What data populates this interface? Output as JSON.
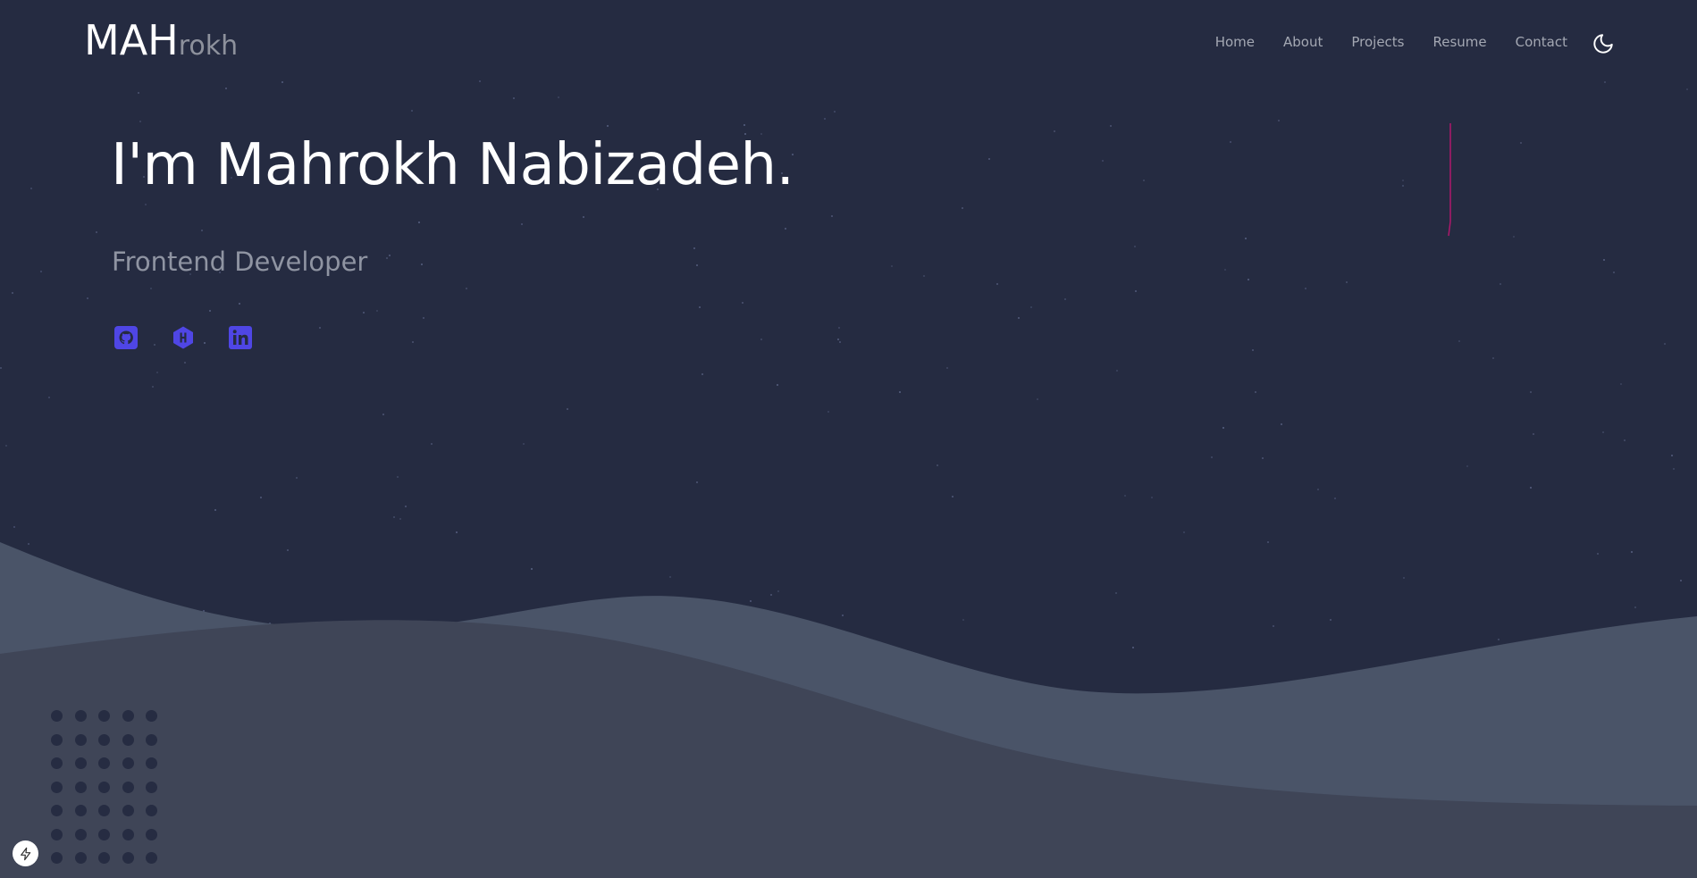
{
  "header": {
    "logo_main": "MAH",
    "logo_rest": "rokh",
    "nav": [
      {
        "label": "Home"
      },
      {
        "label": "About"
      },
      {
        "label": "Projects"
      },
      {
        "label": "Resume"
      },
      {
        "label": "Contact"
      }
    ],
    "theme_icon": "moon-icon"
  },
  "hero": {
    "title": "I'm Mahrokh Nabizadeh.",
    "subtitle": "Frontend Developer"
  },
  "socials": [
    {
      "name": "github",
      "icon": "github-icon"
    },
    {
      "name": "hashnode",
      "icon": "hashnode-icon"
    },
    {
      "name": "linkedin",
      "icon": "linkedin-icon"
    }
  ],
  "colors": {
    "background": "#252b41",
    "accent": "#4f46e5",
    "hill_back": "#4a5468",
    "hill_front": "#3f4557",
    "meteor": "#b0186c"
  },
  "badge_icon": "lightning-icon"
}
